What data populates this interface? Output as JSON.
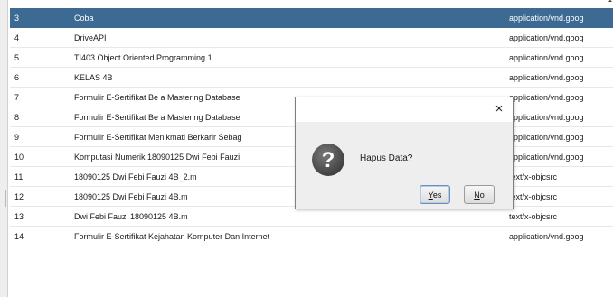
{
  "rows": [
    {
      "no": "3",
      "name": "Coba",
      "mime": "application/vnd.goog"
    },
    {
      "no": "4",
      "name": "DriveAPI",
      "mime": "application/vnd.goog"
    },
    {
      "no": "5",
      "name": "TI403 Object Oriented Programming 1",
      "mime": "application/vnd.goog"
    },
    {
      "no": "6",
      "name": "KELAS 4B",
      "mime": "application/vnd.goog"
    },
    {
      "no": "7",
      "name": "Formulir E-Sertifikat Be a Mastering Database",
      "mime": "application/vnd.goog"
    },
    {
      "no": "8",
      "name": "Formulir E-Sertifikat Be a Mastering Database",
      "mime": "application/vnd.goog"
    },
    {
      "no": "9",
      "name": "Formulir E-Sertifikat Menikmati Berkarir Sebag",
      "mime": "application/vnd.goog"
    },
    {
      "no": "10",
      "name": "Komputasi Numerik 18090125 Dwi Febi Fauzi",
      "mime": "application/vnd.goog"
    },
    {
      "no": "11",
      "name": "18090125 Dwi Febi Fauzi  4B_2.m",
      "mime": "text/x-objcsrc"
    },
    {
      "no": "12",
      "name": "18090125 Dwi Febi Fauzi  4B.m",
      "mime": "text/x-objcsrc"
    },
    {
      "no": "13",
      "name": "Dwi Febi Fauzi 18090125 4B.m",
      "mime": "text/x-objcsrc"
    },
    {
      "no": "14",
      "name": "Formulir E-Sertifikat Kejahatan Komputer Dan Internet",
      "mime": "application/vnd.goog"
    }
  ],
  "selected_row": "3",
  "dialog": {
    "message": "Hapus Data?",
    "yes_label": "Yes",
    "yes_mnemonic": "Y",
    "yes_rest": "es",
    "no_label": "No",
    "no_mnemonic": "N",
    "no_rest": "o",
    "close_glyph": "×",
    "icon": "question-icon"
  },
  "colors": {
    "selection": "#3d6a93",
    "dialog_bg": "#eeeeee",
    "icon_fill": "#5c5c5c"
  }
}
